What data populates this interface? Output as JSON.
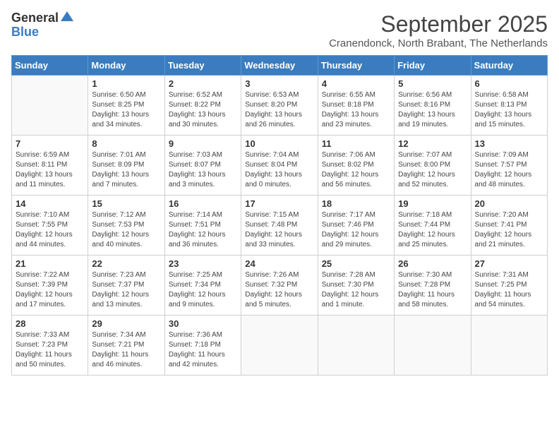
{
  "logo": {
    "general": "General",
    "blue": "Blue"
  },
  "title": "September 2025",
  "location": "Cranendonck, North Brabant, The Netherlands",
  "days_of_week": [
    "Sunday",
    "Monday",
    "Tuesday",
    "Wednesday",
    "Thursday",
    "Friday",
    "Saturday"
  ],
  "weeks": [
    [
      {
        "day": "",
        "info": ""
      },
      {
        "day": "1",
        "info": "Sunrise: 6:50 AM\nSunset: 8:25 PM\nDaylight: 13 hours\nand 34 minutes."
      },
      {
        "day": "2",
        "info": "Sunrise: 6:52 AM\nSunset: 8:22 PM\nDaylight: 13 hours\nand 30 minutes."
      },
      {
        "day": "3",
        "info": "Sunrise: 6:53 AM\nSunset: 8:20 PM\nDaylight: 13 hours\nand 26 minutes."
      },
      {
        "day": "4",
        "info": "Sunrise: 6:55 AM\nSunset: 8:18 PM\nDaylight: 13 hours\nand 23 minutes."
      },
      {
        "day": "5",
        "info": "Sunrise: 6:56 AM\nSunset: 8:16 PM\nDaylight: 13 hours\nand 19 minutes."
      },
      {
        "day": "6",
        "info": "Sunrise: 6:58 AM\nSunset: 8:13 PM\nDaylight: 13 hours\nand 15 minutes."
      }
    ],
    [
      {
        "day": "7",
        "info": "Sunrise: 6:59 AM\nSunset: 8:11 PM\nDaylight: 13 hours\nand 11 minutes."
      },
      {
        "day": "8",
        "info": "Sunrise: 7:01 AM\nSunset: 8:09 PM\nDaylight: 13 hours\nand 7 minutes."
      },
      {
        "day": "9",
        "info": "Sunrise: 7:03 AM\nSunset: 8:07 PM\nDaylight: 13 hours\nand 3 minutes."
      },
      {
        "day": "10",
        "info": "Sunrise: 7:04 AM\nSunset: 8:04 PM\nDaylight: 13 hours\nand 0 minutes."
      },
      {
        "day": "11",
        "info": "Sunrise: 7:06 AM\nSunset: 8:02 PM\nDaylight: 12 hours\nand 56 minutes."
      },
      {
        "day": "12",
        "info": "Sunrise: 7:07 AM\nSunset: 8:00 PM\nDaylight: 12 hours\nand 52 minutes."
      },
      {
        "day": "13",
        "info": "Sunrise: 7:09 AM\nSunset: 7:57 PM\nDaylight: 12 hours\nand 48 minutes."
      }
    ],
    [
      {
        "day": "14",
        "info": "Sunrise: 7:10 AM\nSunset: 7:55 PM\nDaylight: 12 hours\nand 44 minutes."
      },
      {
        "day": "15",
        "info": "Sunrise: 7:12 AM\nSunset: 7:53 PM\nDaylight: 12 hours\nand 40 minutes."
      },
      {
        "day": "16",
        "info": "Sunrise: 7:14 AM\nSunset: 7:51 PM\nDaylight: 12 hours\nand 36 minutes."
      },
      {
        "day": "17",
        "info": "Sunrise: 7:15 AM\nSunset: 7:48 PM\nDaylight: 12 hours\nand 33 minutes."
      },
      {
        "day": "18",
        "info": "Sunrise: 7:17 AM\nSunset: 7:46 PM\nDaylight: 12 hours\nand 29 minutes."
      },
      {
        "day": "19",
        "info": "Sunrise: 7:18 AM\nSunset: 7:44 PM\nDaylight: 12 hours\nand 25 minutes."
      },
      {
        "day": "20",
        "info": "Sunrise: 7:20 AM\nSunset: 7:41 PM\nDaylight: 12 hours\nand 21 minutes."
      }
    ],
    [
      {
        "day": "21",
        "info": "Sunrise: 7:22 AM\nSunset: 7:39 PM\nDaylight: 12 hours\nand 17 minutes."
      },
      {
        "day": "22",
        "info": "Sunrise: 7:23 AM\nSunset: 7:37 PM\nDaylight: 12 hours\nand 13 minutes."
      },
      {
        "day": "23",
        "info": "Sunrise: 7:25 AM\nSunset: 7:34 PM\nDaylight: 12 hours\nand 9 minutes."
      },
      {
        "day": "24",
        "info": "Sunrise: 7:26 AM\nSunset: 7:32 PM\nDaylight: 12 hours\nand 5 minutes."
      },
      {
        "day": "25",
        "info": "Sunrise: 7:28 AM\nSunset: 7:30 PM\nDaylight: 12 hours\nand 1 minute."
      },
      {
        "day": "26",
        "info": "Sunrise: 7:30 AM\nSunset: 7:28 PM\nDaylight: 11 hours\nand 58 minutes."
      },
      {
        "day": "27",
        "info": "Sunrise: 7:31 AM\nSunset: 7:25 PM\nDaylight: 11 hours\nand 54 minutes."
      }
    ],
    [
      {
        "day": "28",
        "info": "Sunrise: 7:33 AM\nSunset: 7:23 PM\nDaylight: 11 hours\nand 50 minutes."
      },
      {
        "day": "29",
        "info": "Sunrise: 7:34 AM\nSunset: 7:21 PM\nDaylight: 11 hours\nand 46 minutes."
      },
      {
        "day": "30",
        "info": "Sunrise: 7:36 AM\nSunset: 7:18 PM\nDaylight: 11 hours\nand 42 minutes."
      },
      {
        "day": "",
        "info": ""
      },
      {
        "day": "",
        "info": ""
      },
      {
        "day": "",
        "info": ""
      },
      {
        "day": "",
        "info": ""
      }
    ]
  ]
}
